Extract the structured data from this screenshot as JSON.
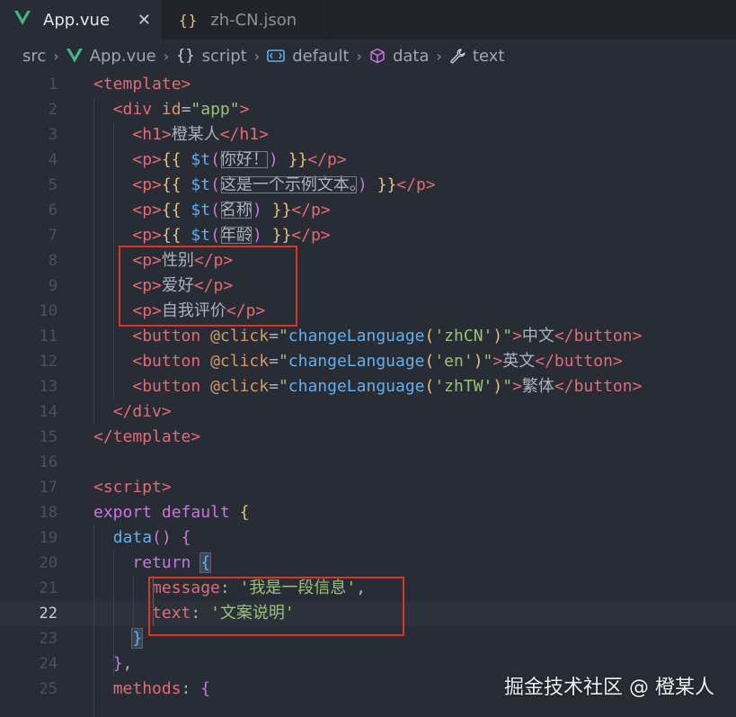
{
  "tabs": [
    {
      "label": "App.vue",
      "active": true
    },
    {
      "label": "zh-CN.json",
      "active": false
    }
  ],
  "tab_close_glyph": "✕",
  "json_icon_glyph": "{}",
  "breadcrumb": {
    "separator": "›",
    "items": [
      {
        "label": "src",
        "icon": null
      },
      {
        "label": "App.vue",
        "icon": "vue-icon"
      },
      {
        "label": "script",
        "icon": "braces-icon"
      },
      {
        "label": "default",
        "icon": "module-icon"
      },
      {
        "label": "data",
        "icon": "cube-icon"
      },
      {
        "label": "text",
        "icon": "wrench-icon"
      }
    ]
  },
  "editor": {
    "current_line": 22,
    "lines": [
      {
        "n": "1",
        "parts": [
          {
            "t": "<template>",
            "c": "t-tag"
          }
        ]
      },
      {
        "n": "2",
        "parts": [
          {
            "t": "  ",
            "c": "t-txt"
          },
          {
            "t": "<div ",
            "c": "t-tag"
          },
          {
            "t": "id",
            "c": "t-attr"
          },
          {
            "t": "=",
            "c": "t-punct"
          },
          {
            "t": "\"app\"",
            "c": "t-str"
          },
          {
            "t": ">",
            "c": "t-tag"
          }
        ]
      },
      {
        "n": "3",
        "parts": [
          {
            "t": "    ",
            "c": "t-txt"
          },
          {
            "t": "<h1>",
            "c": "t-tag"
          },
          {
            "t": "橙某人",
            "c": "t-txt"
          },
          {
            "t": "</h1>",
            "c": "t-tag"
          }
        ]
      },
      {
        "n": "4",
        "parts": [
          {
            "t": "    ",
            "c": "t-txt"
          },
          {
            "t": "<p>",
            "c": "t-tag"
          },
          {
            "t": "{{ ",
            "c": "t-brace"
          },
          {
            "t": "$t",
            "c": "t-fn"
          },
          {
            "t": "(",
            "c": "t-br2"
          },
          {
            "t": "你好！",
            "c": "t-txt",
            "box": true
          },
          {
            "t": ")",
            "c": "t-br2"
          },
          {
            "t": " }}",
            "c": "t-brace"
          },
          {
            "t": "</p>",
            "c": "t-tag"
          }
        ]
      },
      {
        "n": "5",
        "parts": [
          {
            "t": "    ",
            "c": "t-txt"
          },
          {
            "t": "<p>",
            "c": "t-tag"
          },
          {
            "t": "{{ ",
            "c": "t-brace"
          },
          {
            "t": "$t",
            "c": "t-fn"
          },
          {
            "t": "(",
            "c": "t-br2"
          },
          {
            "t": "这是一个示例文本。",
            "c": "t-txt",
            "box": true
          },
          {
            "t": ")",
            "c": "t-br2"
          },
          {
            "t": " }}",
            "c": "t-brace"
          },
          {
            "t": "</p>",
            "c": "t-tag"
          }
        ]
      },
      {
        "n": "6",
        "parts": [
          {
            "t": "    ",
            "c": "t-txt"
          },
          {
            "t": "<p>",
            "c": "t-tag"
          },
          {
            "t": "{{ ",
            "c": "t-brace"
          },
          {
            "t": "$t",
            "c": "t-fn"
          },
          {
            "t": "(",
            "c": "t-br2"
          },
          {
            "t": "名称",
            "c": "t-txt",
            "box": true
          },
          {
            "t": ")",
            "c": "t-br2"
          },
          {
            "t": " }}",
            "c": "t-brace"
          },
          {
            "t": "</p>",
            "c": "t-tag"
          }
        ]
      },
      {
        "n": "7",
        "parts": [
          {
            "t": "    ",
            "c": "t-txt"
          },
          {
            "t": "<p>",
            "c": "t-tag"
          },
          {
            "t": "{{ ",
            "c": "t-brace"
          },
          {
            "t": "$t",
            "c": "t-fn"
          },
          {
            "t": "(",
            "c": "t-br2"
          },
          {
            "t": "年龄",
            "c": "t-txt",
            "box": true
          },
          {
            "t": ")",
            "c": "t-br2"
          },
          {
            "t": " }}",
            "c": "t-brace"
          },
          {
            "t": "</p>",
            "c": "t-tag"
          }
        ]
      },
      {
        "n": "8",
        "parts": [
          {
            "t": "    ",
            "c": "t-txt"
          },
          {
            "t": "<p>",
            "c": "t-tag"
          },
          {
            "t": "性别",
            "c": "t-txt"
          },
          {
            "t": "</p>",
            "c": "t-tag"
          }
        ]
      },
      {
        "n": "9",
        "parts": [
          {
            "t": "    ",
            "c": "t-txt"
          },
          {
            "t": "<p>",
            "c": "t-tag"
          },
          {
            "t": "爱好",
            "c": "t-txt"
          },
          {
            "t": "</p>",
            "c": "t-tag"
          }
        ]
      },
      {
        "n": "10",
        "parts": [
          {
            "t": "    ",
            "c": "t-txt"
          },
          {
            "t": "<p>",
            "c": "t-tag"
          },
          {
            "t": "自我评价",
            "c": "t-txt"
          },
          {
            "t": "</p>",
            "c": "t-tag"
          }
        ]
      },
      {
        "n": "11",
        "parts": [
          {
            "t": "    ",
            "c": "t-txt"
          },
          {
            "t": "<button ",
            "c": "t-tag"
          },
          {
            "t": "@click",
            "c": "t-attr"
          },
          {
            "t": "=",
            "c": "t-punct"
          },
          {
            "t": "\"",
            "c": "t-str"
          },
          {
            "t": "changeLanguage",
            "c": "t-fn"
          },
          {
            "t": "(",
            "c": "t-brace"
          },
          {
            "t": "'zhCN'",
            "c": "t-str"
          },
          {
            "t": ")",
            "c": "t-brace"
          },
          {
            "t": "\"",
            "c": "t-str"
          },
          {
            "t": ">",
            "c": "t-tag"
          },
          {
            "t": "中文",
            "c": "t-txt"
          },
          {
            "t": "</button>",
            "c": "t-tag"
          }
        ]
      },
      {
        "n": "12",
        "parts": [
          {
            "t": "    ",
            "c": "t-txt"
          },
          {
            "t": "<button ",
            "c": "t-tag"
          },
          {
            "t": "@click",
            "c": "t-attr"
          },
          {
            "t": "=",
            "c": "t-punct"
          },
          {
            "t": "\"",
            "c": "t-str"
          },
          {
            "t": "changeLanguage",
            "c": "t-fn"
          },
          {
            "t": "(",
            "c": "t-brace"
          },
          {
            "t": "'en'",
            "c": "t-str"
          },
          {
            "t": ")",
            "c": "t-brace"
          },
          {
            "t": "\"",
            "c": "t-str"
          },
          {
            "t": ">",
            "c": "t-tag"
          },
          {
            "t": "英文",
            "c": "t-txt"
          },
          {
            "t": "</button>",
            "c": "t-tag"
          }
        ]
      },
      {
        "n": "13",
        "parts": [
          {
            "t": "    ",
            "c": "t-txt"
          },
          {
            "t": "<button ",
            "c": "t-tag"
          },
          {
            "t": "@click",
            "c": "t-attr"
          },
          {
            "t": "=",
            "c": "t-punct"
          },
          {
            "t": "\"",
            "c": "t-str"
          },
          {
            "t": "changeLanguage",
            "c": "t-fn"
          },
          {
            "t": "(",
            "c": "t-brace"
          },
          {
            "t": "'zhTW'",
            "c": "t-str"
          },
          {
            "t": ")",
            "c": "t-brace"
          },
          {
            "t": "\"",
            "c": "t-str"
          },
          {
            "t": ">",
            "c": "t-tag"
          },
          {
            "t": "繁体",
            "c": "t-txt"
          },
          {
            "t": "</button>",
            "c": "t-tag"
          }
        ]
      },
      {
        "n": "14",
        "parts": [
          {
            "t": "  ",
            "c": "t-txt"
          },
          {
            "t": "</div>",
            "c": "t-tag"
          }
        ]
      },
      {
        "n": "15",
        "parts": [
          {
            "t": "</template>",
            "c": "t-tag"
          }
        ]
      },
      {
        "n": "16",
        "parts": []
      },
      {
        "n": "17",
        "parts": [
          {
            "t": "<script>",
            "c": "t-tag"
          }
        ]
      },
      {
        "n": "18",
        "parts": [
          {
            "t": "export default ",
            "c": "t-kw"
          },
          {
            "t": "{",
            "c": "t-brace"
          }
        ]
      },
      {
        "n": "19",
        "parts": [
          {
            "t": "  ",
            "c": "t-txt"
          },
          {
            "t": "data",
            "c": "t-fn"
          },
          {
            "t": "() ",
            "c": "t-br2"
          },
          {
            "t": "{",
            "c": "t-br2"
          }
        ]
      },
      {
        "n": "20",
        "parts": [
          {
            "t": "    ",
            "c": "t-txt"
          },
          {
            "t": "return ",
            "c": "t-kw"
          },
          {
            "t": "{",
            "c": "t-br3",
            "hl": true
          }
        ]
      },
      {
        "n": "21",
        "parts": [
          {
            "t": "      ",
            "c": "t-txt"
          },
          {
            "t": "message",
            "c": "t-prop"
          },
          {
            "t": ": ",
            "c": "t-punct"
          },
          {
            "t": "'我是一段信息'",
            "c": "t-str"
          },
          {
            "t": ",",
            "c": "t-punct"
          }
        ]
      },
      {
        "n": "22",
        "parts": [
          {
            "t": "      ",
            "c": "t-txt"
          },
          {
            "t": "text",
            "c": "t-prop"
          },
          {
            "t": ": ",
            "c": "t-punct"
          },
          {
            "t": "'文案说明'",
            "c": "t-str"
          }
        ]
      },
      {
        "n": "23",
        "parts": [
          {
            "t": "    ",
            "c": "t-txt"
          },
          {
            "t": "}",
            "c": "t-br3",
            "hl": true
          }
        ]
      },
      {
        "n": "24",
        "parts": [
          {
            "t": "  ",
            "c": "t-txt"
          },
          {
            "t": "}",
            "c": "t-br2"
          },
          {
            "t": ",",
            "c": "t-punct"
          }
        ]
      },
      {
        "n": "25",
        "parts": [
          {
            "t": "  ",
            "c": "t-txt"
          },
          {
            "t": "methods",
            "c": "t-prop"
          },
          {
            "t": ": ",
            "c": "t-punct"
          },
          {
            "t": "{",
            "c": "t-br2"
          }
        ]
      }
    ]
  },
  "watermark": "掘金技术社区 @ 橙某人",
  "colors": {
    "background": "#282c34",
    "tabbar": "#21252b",
    "annotation_box": "#e0341f",
    "vue_green": "#41b883"
  }
}
